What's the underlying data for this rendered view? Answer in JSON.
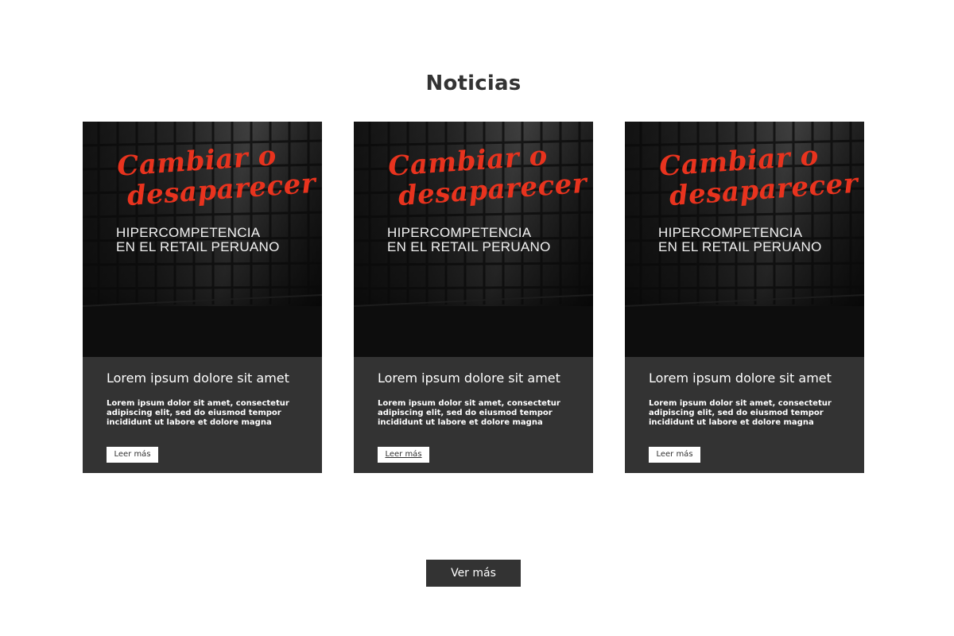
{
  "section": {
    "title": "Noticias"
  },
  "cards": [
    {
      "image": {
        "script_line1": "Cambiar o",
        "script_line2": "desaparecer",
        "sub_line1": "HIPERCOMPETENCIA",
        "sub_line2": "EN EL RETAIL PERUANO"
      },
      "title": "Lorem ipsum dolore sit amet",
      "text": "Lorem ipsum dolor sit amet, consectetur adipiscing elit, sed do eiusmod tempor incididunt ut labore et dolore magna",
      "button_label": "Leer más"
    },
    {
      "image": {
        "script_line1": "Cambiar o",
        "script_line2": "desaparecer",
        "sub_line1": "HIPERCOMPETENCIA",
        "sub_line2": "EN EL RETAIL PERUANO"
      },
      "title": "Lorem ipsum dolore sit amet",
      "text": "Lorem ipsum dolor sit amet, consectetur adipiscing elit, sed do eiusmod tempor incididunt ut labore et dolore magna",
      "button_label": "Leer más"
    },
    {
      "image": {
        "script_line1": "Cambiar o",
        "script_line2": "desaparecer",
        "sub_line1": "HIPERCOMPETENCIA",
        "sub_line2": "EN EL RETAIL PERUANO"
      },
      "title": "Lorem ipsum dolore sit amet",
      "text": "Lorem ipsum dolor sit amet, consectetur adipiscing elit, sed do eiusmod tempor incididunt ut labore et dolore magna",
      "button_label": "Leer más"
    }
  ],
  "footer": {
    "more_label": "Ver más"
  },
  "colors": {
    "card_background": "#333333",
    "accent_red": "#e8331e",
    "text_dark": "#333333"
  }
}
